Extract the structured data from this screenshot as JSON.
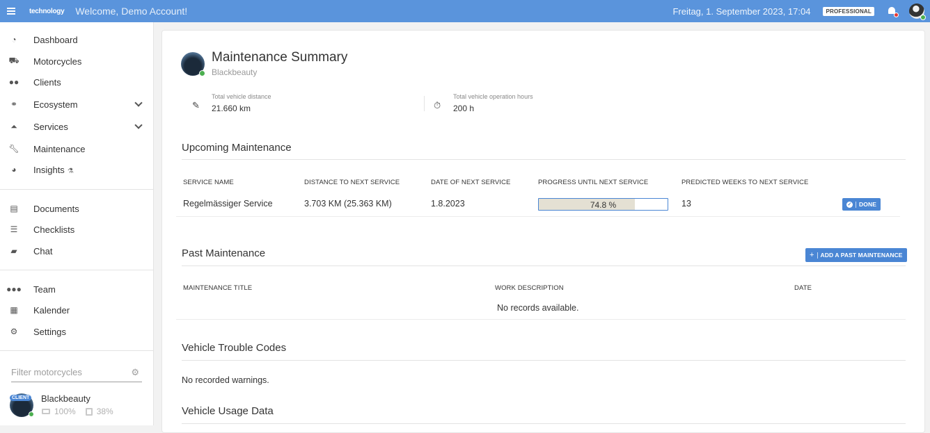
{
  "topbar": {
    "logo": "technology",
    "welcome": "Welcome, Demo Account!",
    "datetime": "Freitag, 1. September 2023, 17:04",
    "plan": "PROFESSIONAL"
  },
  "sidebar": {
    "group1": [
      {
        "label": "Dashboard",
        "icon": "speedometer-icon"
      },
      {
        "label": "Motorcycles",
        "icon": "motorcycle-icon"
      },
      {
        "label": "Clients",
        "icon": "users-icon"
      },
      {
        "label": "Ecosystem",
        "icon": "handshake-icon",
        "expandable": true
      },
      {
        "label": "Services",
        "icon": "service-bell-icon",
        "expandable": true
      },
      {
        "label": "Maintenance",
        "icon": "wrench-icon"
      },
      {
        "label": "Insights",
        "icon": "pie-chart-icon",
        "beta": "flask-icon"
      }
    ],
    "group2": [
      {
        "label": "Documents",
        "icon": "document-icon"
      },
      {
        "label": "Checklists",
        "icon": "checklist-icon"
      },
      {
        "label": "Chat",
        "icon": "chat-icon"
      }
    ],
    "group3": [
      {
        "label": "Team",
        "icon": "team-icon"
      },
      {
        "label": "Kalender",
        "icon": "calendar-icon"
      },
      {
        "label": "Settings",
        "icon": "gear-icon"
      }
    ],
    "filter_placeholder": "Filter motorcycles",
    "motorcycle": {
      "badge": "CLIENT",
      "name": "Blackbeauty",
      "battery": "100%",
      "fuel": "38%"
    }
  },
  "main": {
    "title": "Maintenance Summary",
    "subtitle": "Blackbeauty",
    "stats": [
      {
        "label": "Total vehicle distance",
        "value": "21.660 km",
        "icon": "ruler-icon"
      },
      {
        "label": "Total vehicle operation hours",
        "value": "200 h",
        "icon": "stopwatch-icon"
      }
    ],
    "upcoming": {
      "title": "Upcoming Maintenance",
      "columns": [
        "SERVICE NAME",
        "DISTANCE TO NEXT SERVICE",
        "DATE OF NEXT SERVICE",
        "PROGRESS UNTIL NEXT SERVICE",
        "PREDICTED WEEKS TO NEXT SERVICE"
      ],
      "row": {
        "service": "Regelmässiger Service",
        "distance": "3.703 KM (25.363 KM)",
        "date": "1.8.2023",
        "progress_text": "74.8 %",
        "progress": 0.748,
        "weeks": "13",
        "action": "DONE"
      }
    },
    "past": {
      "title": "Past Maintenance",
      "add_button": "ADD A PAST MAINTENANCE",
      "columns": [
        "MAINTENANCE TITLE",
        "WORK DESCRIPTION",
        "DATE"
      ],
      "empty": "No records available."
    },
    "trouble_codes": {
      "title": "Vehicle Trouble Codes",
      "empty": "No recorded warnings."
    },
    "usage": {
      "title": "Vehicle Usage Data"
    }
  },
  "colors": {
    "topbar": "#5a94dc",
    "accent": "#4a86d4",
    "online": "#4caf50",
    "alert": "#e53935"
  }
}
